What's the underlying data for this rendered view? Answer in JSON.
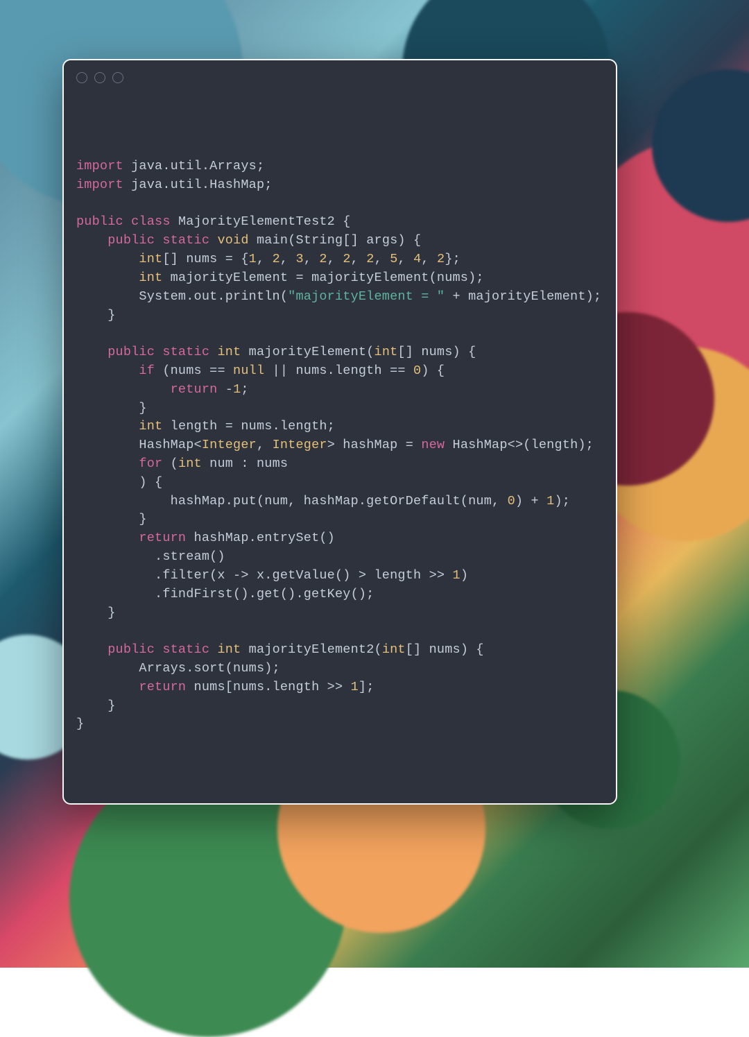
{
  "code": {
    "tokens": [
      [
        {
          "t": "import ",
          "c": "c-pink"
        },
        {
          "t": "java.util.Arrays;",
          "c": "c-gray"
        }
      ],
      [
        {
          "t": "import ",
          "c": "c-pink"
        },
        {
          "t": "java.util.HashMap;",
          "c": "c-gray"
        }
      ],
      [],
      [
        {
          "t": "public class ",
          "c": "c-pink"
        },
        {
          "t": "MajorityElementTest2 {",
          "c": "c-gray"
        }
      ],
      [
        {
          "t": "    ",
          "c": "c-gray"
        },
        {
          "t": "public static ",
          "c": "c-pink"
        },
        {
          "t": "void ",
          "c": "c-yellow"
        },
        {
          "t": "main",
          "c": "c-gray"
        },
        {
          "t": "(",
          "c": "c-gray"
        },
        {
          "t": "String",
          "c": "c-gray"
        },
        {
          "t": "[] args) {",
          "c": "c-gray"
        }
      ],
      [
        {
          "t": "        ",
          "c": "c-gray"
        },
        {
          "t": "int",
          "c": "c-yellow"
        },
        {
          "t": "[] nums = {",
          "c": "c-gray"
        },
        {
          "t": "1",
          "c": "c-yellow"
        },
        {
          "t": ", ",
          "c": "c-gray"
        },
        {
          "t": "2",
          "c": "c-yellow"
        },
        {
          "t": ", ",
          "c": "c-gray"
        },
        {
          "t": "3",
          "c": "c-yellow"
        },
        {
          "t": ", ",
          "c": "c-gray"
        },
        {
          "t": "2",
          "c": "c-yellow"
        },
        {
          "t": ", ",
          "c": "c-gray"
        },
        {
          "t": "2",
          "c": "c-yellow"
        },
        {
          "t": ", ",
          "c": "c-gray"
        },
        {
          "t": "2",
          "c": "c-yellow"
        },
        {
          "t": ", ",
          "c": "c-gray"
        },
        {
          "t": "5",
          "c": "c-yellow"
        },
        {
          "t": ", ",
          "c": "c-gray"
        },
        {
          "t": "4",
          "c": "c-yellow"
        },
        {
          "t": ", ",
          "c": "c-gray"
        },
        {
          "t": "2",
          "c": "c-yellow"
        },
        {
          "t": "};",
          "c": "c-gray"
        }
      ],
      [
        {
          "t": "        ",
          "c": "c-gray"
        },
        {
          "t": "int ",
          "c": "c-yellow"
        },
        {
          "t": "majorityElement = majorityElement(nums);",
          "c": "c-gray"
        }
      ],
      [
        {
          "t": "        System.out.println(",
          "c": "c-gray"
        },
        {
          "t": "\"majorityElement = \"",
          "c": "c-teal"
        },
        {
          "t": " + majorityElement);",
          "c": "c-gray"
        }
      ],
      [
        {
          "t": "    }",
          "c": "c-gray"
        }
      ],
      [],
      [
        {
          "t": "    ",
          "c": "c-gray"
        },
        {
          "t": "public static ",
          "c": "c-pink"
        },
        {
          "t": "int ",
          "c": "c-yellow"
        },
        {
          "t": "majorityElement(",
          "c": "c-gray"
        },
        {
          "t": "int",
          "c": "c-yellow"
        },
        {
          "t": "[] nums) {",
          "c": "c-gray"
        }
      ],
      [
        {
          "t": "        ",
          "c": "c-gray"
        },
        {
          "t": "if ",
          "c": "c-pink"
        },
        {
          "t": "(nums == ",
          "c": "c-gray"
        },
        {
          "t": "null ",
          "c": "c-yellow"
        },
        {
          "t": "|| nums.length == ",
          "c": "c-gray"
        },
        {
          "t": "0",
          "c": "c-yellow"
        },
        {
          "t": ") {",
          "c": "c-gray"
        }
      ],
      [
        {
          "t": "            ",
          "c": "c-gray"
        },
        {
          "t": "return ",
          "c": "c-pink"
        },
        {
          "t": "-",
          "c": "c-gray"
        },
        {
          "t": "1",
          "c": "c-yellow"
        },
        {
          "t": ";",
          "c": "c-gray"
        }
      ],
      [
        {
          "t": "        }",
          "c": "c-gray"
        }
      ],
      [
        {
          "t": "        ",
          "c": "c-gray"
        },
        {
          "t": "int ",
          "c": "c-yellow"
        },
        {
          "t": "length = nums.length;",
          "c": "c-gray"
        }
      ],
      [
        {
          "t": "        HashMap<",
          "c": "c-gray"
        },
        {
          "t": "Integer",
          "c": "c-yellow"
        },
        {
          "t": ", ",
          "c": "c-gray"
        },
        {
          "t": "Integer",
          "c": "c-yellow"
        },
        {
          "t": "> hashMap = ",
          "c": "c-gray"
        },
        {
          "t": "new ",
          "c": "c-pink"
        },
        {
          "t": "HashMap<>(length);",
          "c": "c-gray"
        }
      ],
      [
        {
          "t": "        ",
          "c": "c-gray"
        },
        {
          "t": "for ",
          "c": "c-pink"
        },
        {
          "t": "(",
          "c": "c-gray"
        },
        {
          "t": "int ",
          "c": "c-yellow"
        },
        {
          "t": "num : nums",
          "c": "c-gray"
        }
      ],
      [
        {
          "t": "        ) {",
          "c": "c-gray"
        }
      ],
      [
        {
          "t": "            hashMap.put(num, hashMap.getOrDefault(num, ",
          "c": "c-gray"
        },
        {
          "t": "0",
          "c": "c-yellow"
        },
        {
          "t": ") + ",
          "c": "c-gray"
        },
        {
          "t": "1",
          "c": "c-yellow"
        },
        {
          "t": ");",
          "c": "c-gray"
        }
      ],
      [
        {
          "t": "        }",
          "c": "c-gray"
        }
      ],
      [
        {
          "t": "        ",
          "c": "c-gray"
        },
        {
          "t": "return ",
          "c": "c-pink"
        },
        {
          "t": "hashMap.entrySet()",
          "c": "c-gray"
        }
      ],
      [
        {
          "t": "          .stream()",
          "c": "c-gray"
        }
      ],
      [
        {
          "t": "          .filter(x -> x.getValue() > length >> ",
          "c": "c-gray"
        },
        {
          "t": "1",
          "c": "c-yellow"
        },
        {
          "t": ")",
          "c": "c-gray"
        }
      ],
      [
        {
          "t": "          .findFirst().get().getKey();",
          "c": "c-gray"
        }
      ],
      [
        {
          "t": "    }",
          "c": "c-gray"
        }
      ],
      [],
      [
        {
          "t": "    ",
          "c": "c-gray"
        },
        {
          "t": "public static ",
          "c": "c-pink"
        },
        {
          "t": "int ",
          "c": "c-yellow"
        },
        {
          "t": "majorityElement2(",
          "c": "c-gray"
        },
        {
          "t": "int",
          "c": "c-yellow"
        },
        {
          "t": "[] nums) {",
          "c": "c-gray"
        }
      ],
      [
        {
          "t": "        Arrays.sort(nums);",
          "c": "c-gray"
        }
      ],
      [
        {
          "t": "        ",
          "c": "c-gray"
        },
        {
          "t": "return ",
          "c": "c-pink"
        },
        {
          "t": "nums[nums.length >> ",
          "c": "c-gray"
        },
        {
          "t": "1",
          "c": "c-yellow"
        },
        {
          "t": "];",
          "c": "c-gray"
        }
      ],
      [
        {
          "t": "    }",
          "c": "c-gray"
        }
      ],
      [
        {
          "t": "}",
          "c": "c-gray"
        }
      ]
    ]
  },
  "colors": {
    "editor_bg": "#2d323c",
    "keyword": "#d6699e",
    "type": "#e5c07b",
    "string": "#5fb3a1",
    "default": "#c5cdd9"
  }
}
